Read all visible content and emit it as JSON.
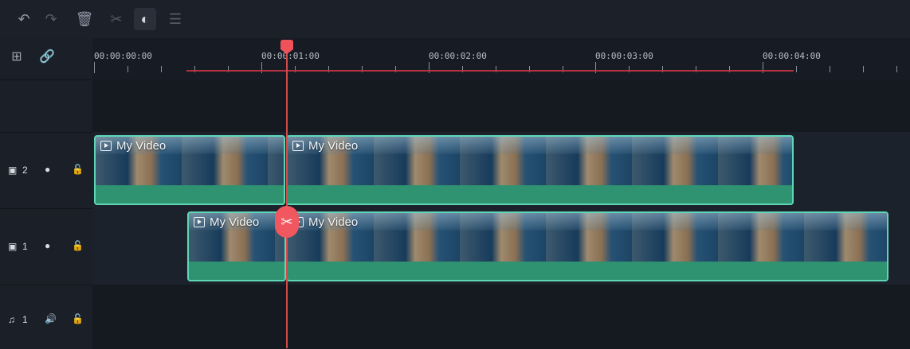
{
  "toolbar": {
    "icons": [
      "undo-icon",
      "redo-icon",
      "delete-icon",
      "cut-icon",
      "color-icon",
      "adjust-icon"
    ]
  },
  "ruler": {
    "labels": [
      "00:00:00:00",
      "00:00:01:00",
      "00:00:02:00",
      "00:00:03:00",
      "00:00:04:00"
    ]
  },
  "tracks": {
    "video2": {
      "index": "2"
    },
    "video1": {
      "index": "1"
    },
    "audio1": {
      "index": "1"
    }
  },
  "clips": {
    "v2_a": "My Video",
    "v2_b": "My Video",
    "v1_a": "My Video",
    "v1_b": "My Video"
  },
  "colors": {
    "playhead": "#f0525a",
    "clip_border": "#5fd7b7",
    "clip_audio": "#2f9270",
    "range_bar": "#b53240"
  }
}
